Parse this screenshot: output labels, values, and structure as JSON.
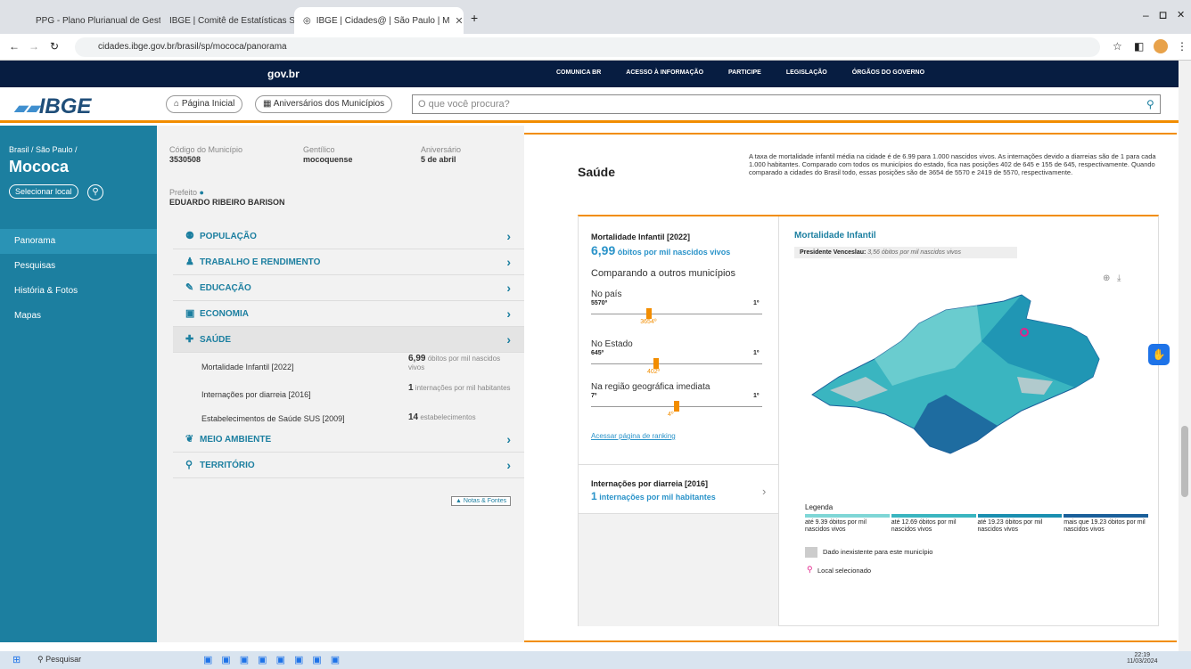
{
  "browser": {
    "tabs": [
      "PPG - Plano Plurianual de Gest",
      "IBGE | Comitê de Estatísticas Soc",
      "IBGE | Cidades@ | São Paulo | M"
    ],
    "url": "cidades.ibge.gov.br/brasil/sp/mococa/panorama"
  },
  "govbar": {
    "logo": "gov.br",
    "links": [
      "COMUNICA BR",
      "ACESSO À INFORMAÇÃO",
      "PARTICIPE",
      "LEGISLAÇÃO",
      "ÓRGÃOS DO GOVERNO"
    ]
  },
  "header": {
    "logo": "IBGE",
    "home": "Página Inicial",
    "anniversaries": "Aniversários dos Municípios",
    "search_placeholder": "O que você procura?"
  },
  "sidebar": {
    "location": "Brasil / São Paulo /",
    "city": "Mococa",
    "select": "Selecionar local",
    "items": [
      "Panorama",
      "Pesquisas",
      "História & Fotos",
      "Mapas"
    ]
  },
  "info": {
    "code_label": "Código do Município",
    "code": "3530508",
    "gentilico_label": "Gentílico",
    "gentilico": "mocoquense",
    "anniv_label": "Aniversário",
    "anniv": "5 de abril",
    "mayor_label": "Prefeito",
    "mayor": "EDUARDO RIBEIRO BARISON",
    "categories": [
      "POPULAÇÃO",
      "TRABALHO E RENDIMENTO",
      "EDUCAÇÃO",
      "ECONOMIA",
      "SAÚDE",
      "MEIO AMBIENTE",
      "TERRITÓRIO"
    ],
    "health_items": [
      {
        "label": "Mortalidade Infantil [2022]",
        "value": "6,99",
        "unit": "óbitos por mil nascidos vivos"
      },
      {
        "label": "Internações por diarreia [2016]",
        "value": "1",
        "unit": "internações por mil habitantes"
      },
      {
        "label": "Estabelecimentos de Saúde SUS [2009]",
        "value": "14",
        "unit": "estabelecimentos"
      }
    ],
    "notes": "Notas & Fontes"
  },
  "main": {
    "title": "Saúde",
    "description": "A taxa de mortalidade infantil média na cidade é de 6.99 para 1.000 nascidos vivos. As internações devido a diarreias são de 1 para cada 1.000 habitantes. Comparado com todos os municípios do estado, fica nas posições 402 de 645 e 155 de 645, respectivamente. Quando comparado a cidades do Brasil todo, essas posições são de 3654 de 5570 e 2419 de 5570, respectivamente.",
    "mortality": {
      "title": "Mortalidade Infantil [2022]",
      "value": "6,99",
      "unit": "óbitos por mil nascidos vivos",
      "compare": "Comparando a outros municípios",
      "ranks": [
        {
          "label": "No país",
          "max": "5570º",
          "min": "1º",
          "pos": "3654º",
          "frac": 0.34
        },
        {
          "label": "No Estado",
          "max": "645º",
          "min": "1º",
          "pos": "402º",
          "frac": 0.38
        },
        {
          "label": "Na região geográfica imediata",
          "max": "7º",
          "min": "1º",
          "pos": "4º",
          "frac": 0.5
        }
      ],
      "link": "Acessar página de ranking"
    },
    "diarrhea": {
      "title": "Internações por diarreia [2016]",
      "value": "1",
      "unit": "internações por mil habitantes"
    },
    "map": {
      "title": "Mortalidade Infantil",
      "highlight_label": "Presidente Venceslau:",
      "highlight_value": "3,56 óbitos por mil nascidos vivos",
      "legend_title": "Legenda",
      "legend": [
        {
          "label": "até 9.39 óbitos por mil nascidos vivos",
          "color": "#7fd6d6"
        },
        {
          "label": "até 12.69 óbitos por mil nascidos vivos",
          "color": "#3ab5c0"
        },
        {
          "label": "até 19.23 óbitos por mil nascidos vivos",
          "color": "#1a8fb0"
        },
        {
          "label": "mais que 19.23 óbitos por mil nascidos vivos",
          "color": "#1a5f9a"
        }
      ],
      "no_data": "Dado inexistente para este município",
      "selected": "Local selecionado"
    }
  },
  "taskbar": {
    "search": "Pesquisar",
    "time": "22:19",
    "date": "11/03/2024"
  }
}
